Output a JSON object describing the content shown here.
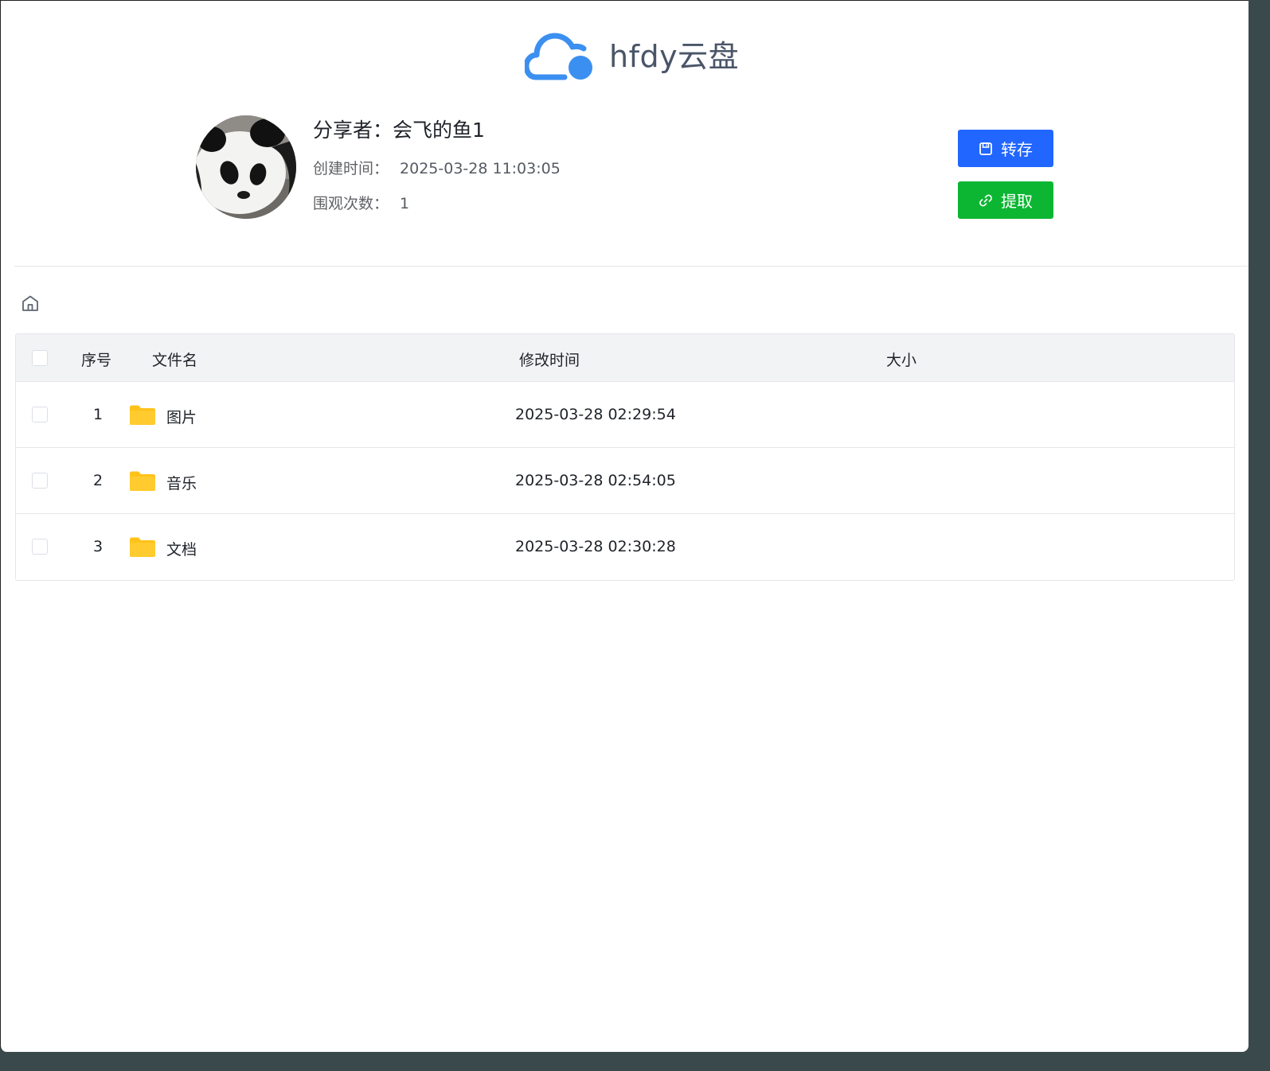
{
  "app": {
    "name": "hfdy云盘",
    "logo_icon": "cloud-icon",
    "brand_color": "#3b8ff0"
  },
  "share": {
    "title": "分享者：会飞的鱼1",
    "created_label": "创建时间：",
    "created_value": "2025-03-28 11:03:05",
    "views_label": "围观次数：",
    "views_value": "1",
    "avatar": "panda-avatar"
  },
  "actions": {
    "save_label": "转存",
    "save_icon": "save-icon",
    "save_color": "#2066ff",
    "extract_label": "提取",
    "extract_icon": "link-icon",
    "extract_color": "#0cb633"
  },
  "breadcrumb": {
    "home_icon": "home-icon"
  },
  "table": {
    "columns": {
      "index": "序号",
      "name": "文件名",
      "modified": "修改时间",
      "size": "大小"
    },
    "rows": [
      {
        "index": "1",
        "icon": "folder-icon",
        "name": "图片",
        "modified": "2025-03-28 02:29:54",
        "size": ""
      },
      {
        "index": "2",
        "icon": "folder-icon",
        "name": "音乐",
        "modified": "2025-03-28 02:54:05",
        "size": ""
      },
      {
        "index": "3",
        "icon": "folder-icon",
        "name": "文档",
        "modified": "2025-03-28 02:30:28",
        "size": ""
      }
    ]
  }
}
